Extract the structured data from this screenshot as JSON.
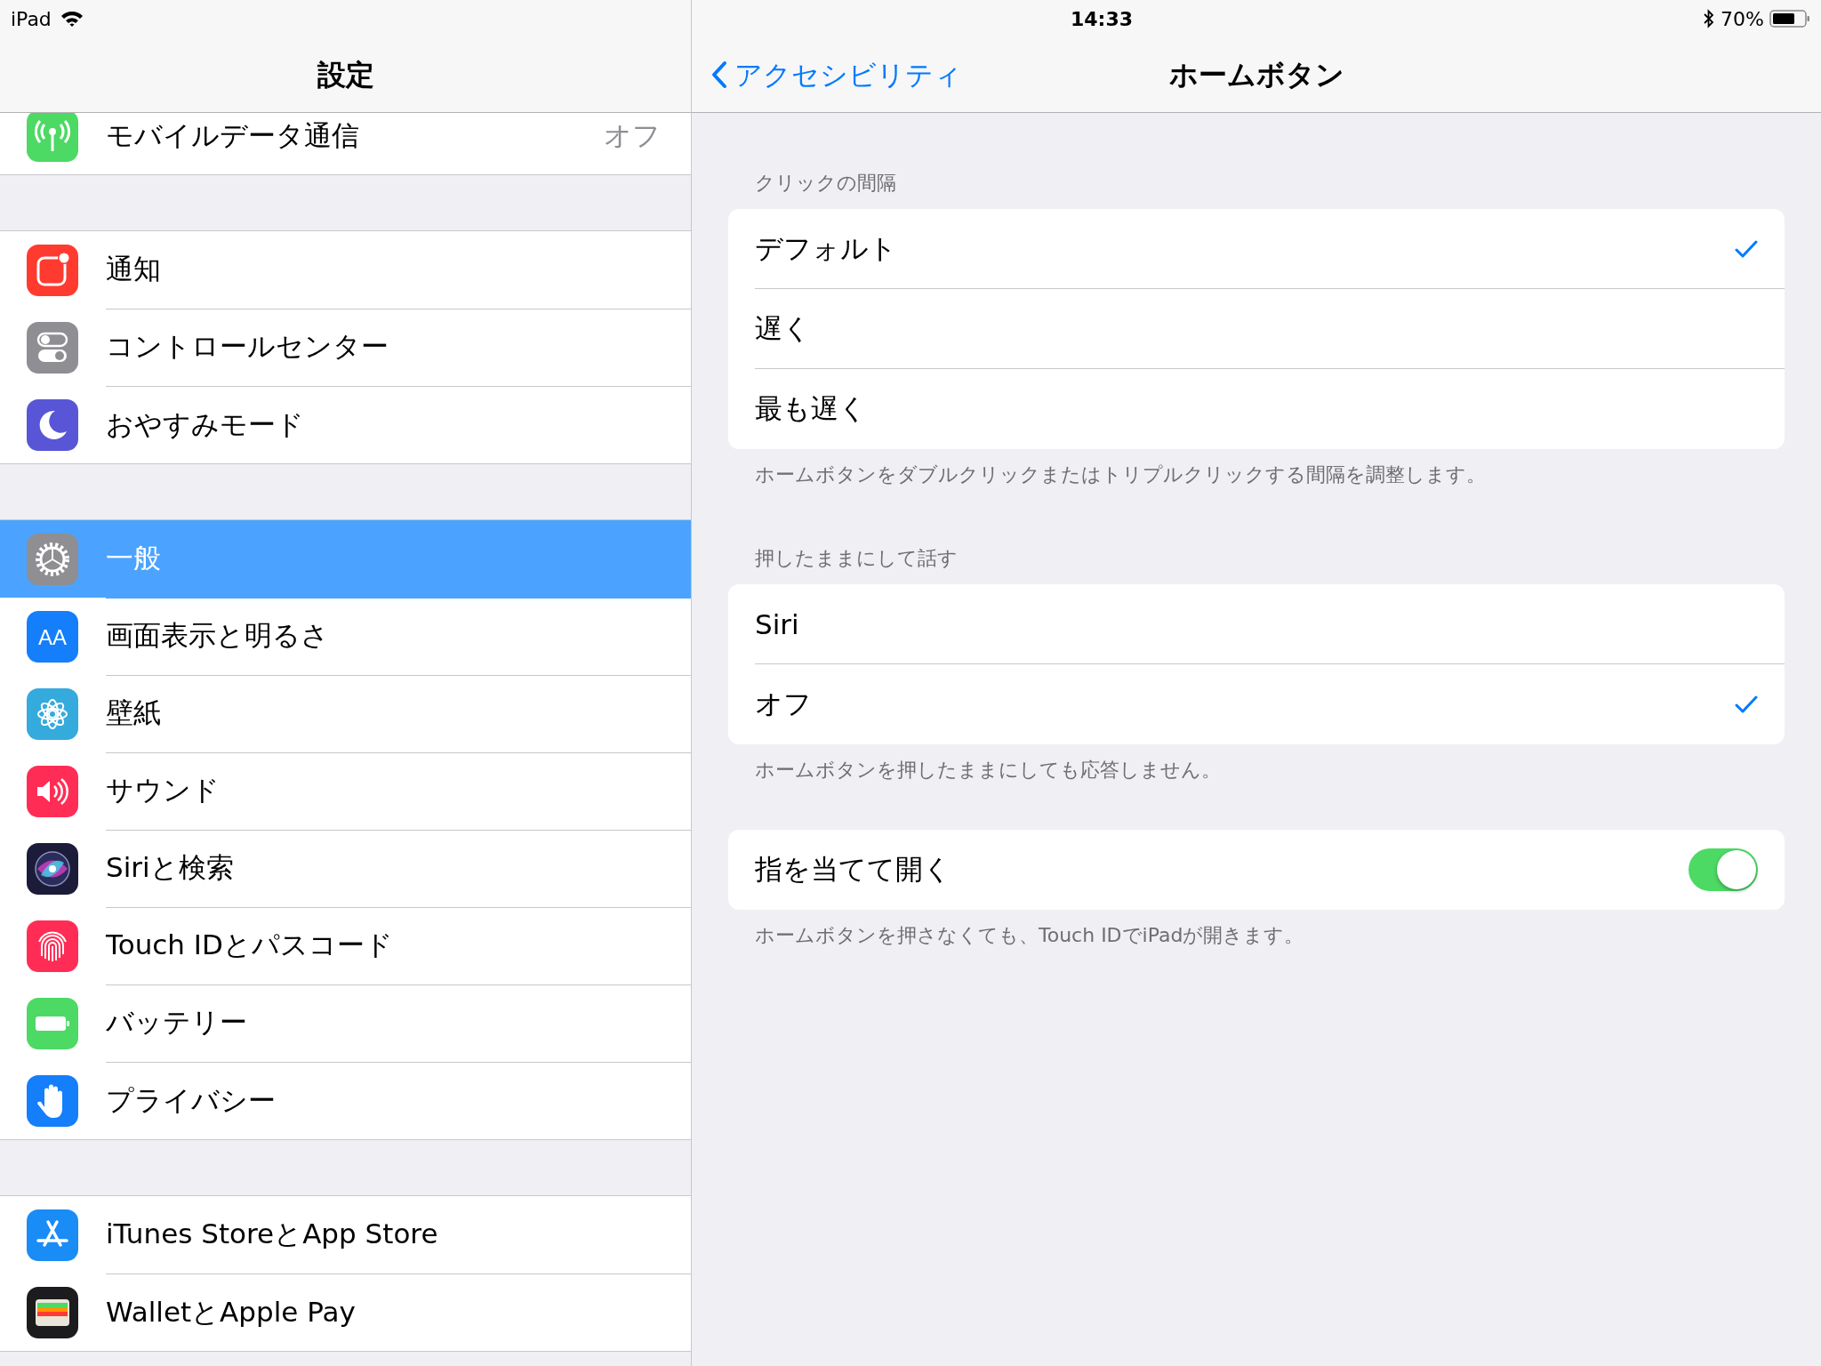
{
  "status_bar": {
    "device": "iPad",
    "time": "14:33",
    "battery": "70%"
  },
  "sidebar": {
    "title": "設定",
    "groups": [
      [
        {
          "kind": "cellular",
          "color": "#4cd964",
          "label": "モバイルデータ通信",
          "value": "オフ",
          "selected": false
        }
      ],
      [
        {
          "kind": "notifications",
          "color": "#ff3b30",
          "label": "通知",
          "selected": false
        },
        {
          "kind": "control",
          "color": "#8e8e93",
          "label": "コントロールセンター",
          "selected": false
        },
        {
          "kind": "moon",
          "color": "#5856d6",
          "label": "おやすみモード",
          "selected": false
        }
      ],
      [
        {
          "kind": "gear",
          "color": "#8e8e93",
          "label": "一般",
          "selected": true
        },
        {
          "kind": "text",
          "color": "#147efb",
          "glyph": "AA",
          "label": "画面表示と明るさ",
          "selected": false
        },
        {
          "kind": "flower",
          "color": "#35aadc",
          "label": "壁紙",
          "selected": false
        },
        {
          "kind": "sound",
          "color": "#ff2d55",
          "label": "サウンド",
          "selected": false
        },
        {
          "kind": "siri",
          "color": "#1c1c3a",
          "label": "Siriと検索",
          "selected": false
        },
        {
          "kind": "fingerprint",
          "color": "#ff2d55",
          "label": "Touch IDとパスコード",
          "selected": false
        },
        {
          "kind": "battery",
          "color": "#4cd964",
          "label": "バッテリー",
          "selected": false
        },
        {
          "kind": "hand",
          "color": "#147efb",
          "label": "プライバシー",
          "selected": false
        }
      ],
      [
        {
          "kind": "appstore",
          "color": "#1a8cf5",
          "label": "iTunes StoreとApp Store",
          "selected": false
        },
        {
          "kind": "wallet",
          "color": "#1c1c1e",
          "label": "WalletとApple Pay",
          "selected": false
        }
      ]
    ]
  },
  "detail": {
    "back": "アクセシビリティ",
    "title": "ホームボタン",
    "sections": [
      {
        "header": "クリックの間隔",
        "rows": [
          {
            "kind": "check",
            "label": "デフォルト",
            "checked": true
          },
          {
            "kind": "check",
            "label": "遅く",
            "checked": false
          },
          {
            "kind": "check",
            "label": "最も遅く",
            "checked": false
          }
        ],
        "footer": "ホームボタンをダブルクリックまたはトリプルクリックする間隔を調整します。"
      },
      {
        "header": "押したままにして話す",
        "rows": [
          {
            "kind": "check",
            "label": "Siri",
            "checked": false
          },
          {
            "kind": "check",
            "label": "オフ",
            "checked": true
          }
        ],
        "footer": "ホームボタンを押したままにしても応答しません。"
      },
      {
        "rows": [
          {
            "kind": "toggle",
            "label": "指を当てて開く",
            "on": true
          }
        ],
        "footer": "ホームボタンを押さなくても、Touch IDでiPadが開きます。"
      }
    ]
  }
}
